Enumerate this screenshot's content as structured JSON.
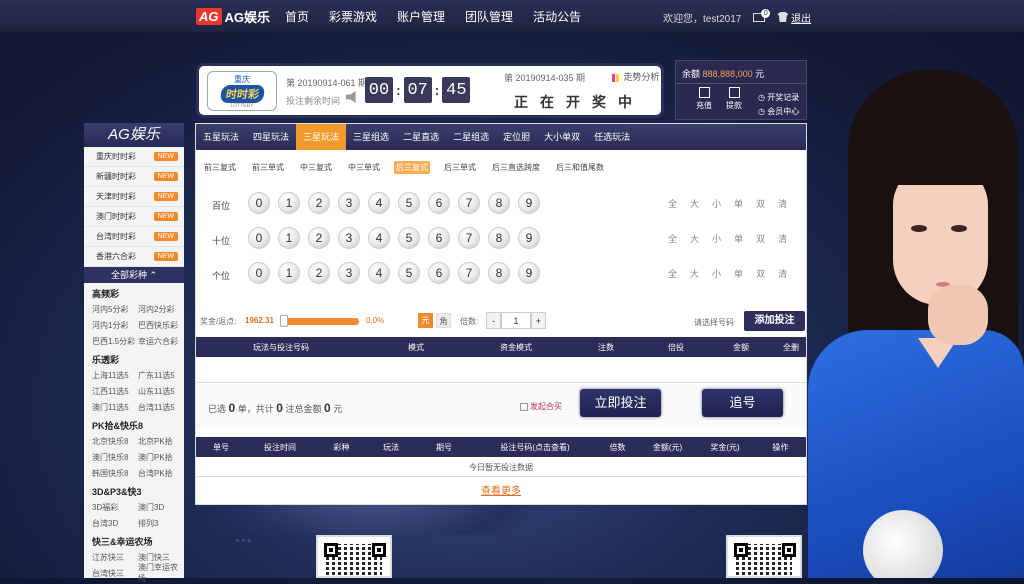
{
  "topbar": {
    "logo_ag": "AG",
    "logo_text": "AG娱乐",
    "nav": [
      "首页",
      "彩票游戏",
      "账户管理",
      "团队管理",
      "活动公告"
    ],
    "welcome": "欢迎您，test2017",
    "mail_count": "0",
    "logout": "退出"
  },
  "header": {
    "brand_line1": "重庆",
    "brand_line2": "时时彩",
    "brand_line3": "LOTTERY",
    "current_issue": "第 20190914-061 期",
    "countdown_label": "投注剩余时间",
    "timer": [
      "00",
      "07",
      "45"
    ],
    "last_issue": "第 20190914-035 期",
    "trend": "走势分析",
    "status": "正在开奖中"
  },
  "account": {
    "balance_label": "余额",
    "balance": "888,888,000",
    "currency": "元",
    "recharge": "充值",
    "withdraw": "提款",
    "open_record": "开奖记录",
    "member_center": "会员中心"
  },
  "sidebar": {
    "title": "AG娱乐",
    "hot": [
      {
        "name": "重庆时时彩",
        "tag": "NEW"
      },
      {
        "name": "新疆时时彩",
        "tag": "NEW"
      },
      {
        "name": "天津时时彩",
        "tag": "NEW"
      },
      {
        "name": "澳门时时彩",
        "tag": "NEW"
      },
      {
        "name": "台湾时时彩",
        "tag": "NEW"
      },
      {
        "name": "香港六合彩",
        "tag": "NEW"
      }
    ],
    "all_games": "全部彩种",
    "categories": [
      {
        "name": "高频彩",
        "rows": [
          [
            "河内5分彩",
            "河内2分彩"
          ],
          [
            "河内1分彩",
            "巴西快乐彩"
          ],
          [
            "巴西1.5分彩",
            "幸运六合彩"
          ]
        ]
      },
      {
        "name": "乐透彩",
        "rows": [
          [
            "上海11选5",
            "广东11选5"
          ],
          [
            "江西11选5",
            "山东11选5"
          ],
          [
            "澳门11选5",
            "台湾11选5"
          ]
        ]
      },
      {
        "name": "PK拾&快乐8",
        "rows": [
          [
            "北京快乐8",
            "北京PK拾"
          ],
          [
            "澳门快乐8",
            "澳门PK拾"
          ],
          [
            "韩国快乐8",
            "台湾PK拾"
          ]
        ]
      },
      {
        "name": "3D&P3&快3",
        "rows": [
          [
            "3D福彩",
            "澳门3D"
          ],
          [
            "台湾3D",
            "排列3"
          ]
        ]
      },
      {
        "name": "快三&幸运农场",
        "rows": [
          [
            "江苏快三",
            "澳门快三"
          ],
          [
            "台湾快三",
            "澳门幸运农场"
          ]
        ]
      }
    ]
  },
  "tabs": [
    "五星玩法",
    "四星玩法",
    "三星玩法",
    "三星组选",
    "二星直选",
    "二星组选",
    "定位胆",
    "大小单双",
    "任选玩法"
  ],
  "active_tab": 2,
  "subtabs": [
    "前三复式",
    "前三单式",
    "中三复式",
    "中三单式",
    "后三复式",
    "后三单式",
    "后三直选跨度",
    "后三和值尾数"
  ],
  "active_subtab": 4,
  "positions": [
    "百位",
    "十位",
    "个位"
  ],
  "digits": [
    "0",
    "1",
    "2",
    "3",
    "4",
    "5",
    "6",
    "7",
    "8",
    "9"
  ],
  "quick_select": [
    "全",
    "大",
    "小",
    "单",
    "双",
    "清"
  ],
  "bet": {
    "odds_label": "奖金/返点:",
    "odds": "1962.31",
    "rebate": "0.0%",
    "rebate_fraction": 0.0,
    "unit_yuan": "元",
    "unit_jiao": "角",
    "multiplier_label": "倍数:",
    "minus": "-",
    "multiplier": "1",
    "plus": "+",
    "hint": "请选择号码",
    "add_button": "添加投注"
  },
  "bet_table_headers": [
    "玩法与投注号码",
    "模式",
    "资金模式",
    "注数",
    "倍投",
    "金额",
    "全删"
  ],
  "summary": {
    "t1": "已选",
    "orders": "0",
    "t2": "单，共计",
    "bets": "0",
    "t3": "注总金额",
    "amount": "0",
    "t4": "元",
    "chase_label": "发起合买",
    "submit": "立即投注",
    "chase_button": "追号"
  },
  "record_headers": [
    "单号",
    "投注时间",
    "彩种",
    "玩法",
    "期号",
    "投注号码(点击查看)",
    "倍数",
    "金额(元)",
    "奖金(元)",
    "操作"
  ],
  "record_empty": "今日暂无投注数据",
  "see_more": "查看更多"
}
